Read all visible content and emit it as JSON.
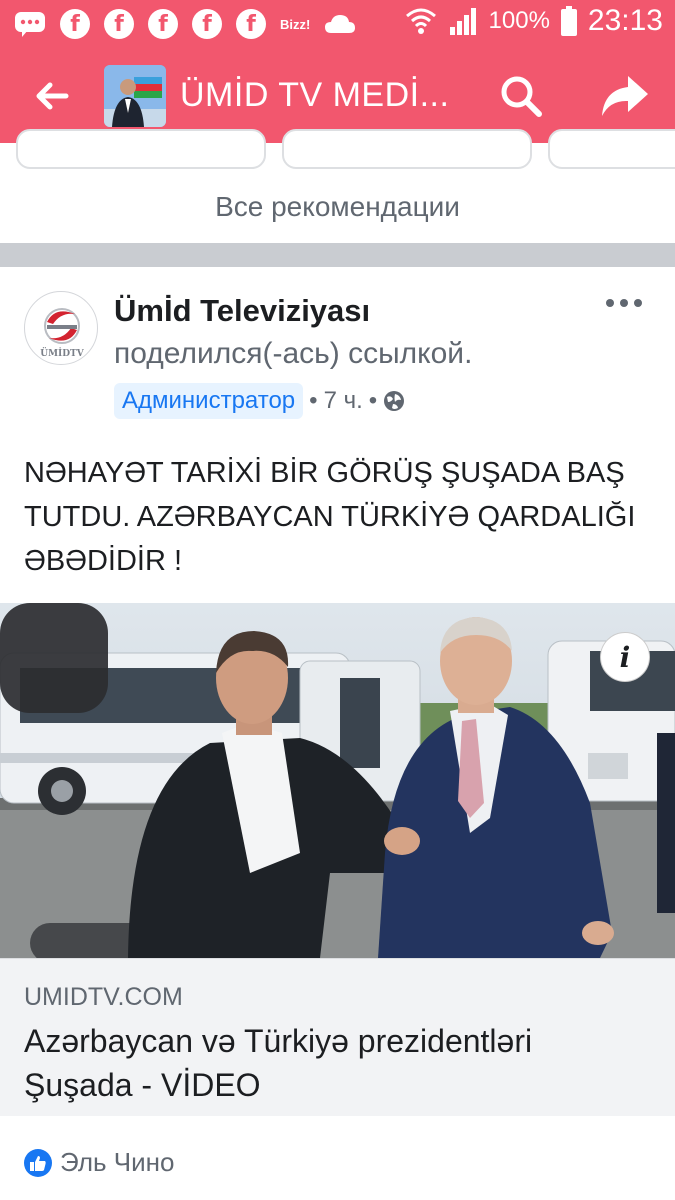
{
  "status_bar": {
    "notifications": [
      "message-icon",
      "facebook-icon",
      "facebook-icon",
      "facebook-icon",
      "facebook-icon",
      "facebook-icon"
    ],
    "bizz_label": "Bizz!",
    "battery_pct": "100%",
    "time": "23:13"
  },
  "header": {
    "page_name": "ÜMİD TV MEDİ...",
    "color": "#f2576e"
  },
  "recommendations": {
    "see_all": "Все рекомендации"
  },
  "post": {
    "author": "Ümİd Televiziyası",
    "action": "поделился(-ась) ссылкой.",
    "role": "Администратор",
    "time": "7 ч.",
    "text": "NƏHAYƏT TARİXİ BİR GÖRÜŞ ŞUŞADA BAŞ TUTDU. AZƏRBAYCAN TÜRKİYƏ QARDALIĞI ƏBƏDİDİR !",
    "logo_caption": "ÜMİDTV",
    "info_label": "i",
    "link": {
      "domain": "UMIDTV.COM",
      "title": "Azərbaycan və Türkiyə prezidentləri Şuşada - VİDEO"
    },
    "reactions": {
      "liked_by": "Эль Чино"
    }
  }
}
